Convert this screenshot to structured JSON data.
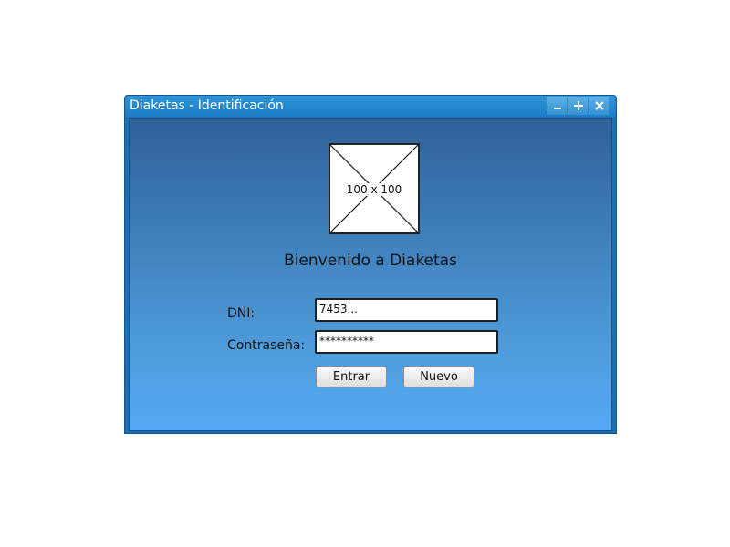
{
  "window": {
    "title": "Diaketas - Identificación",
    "controls": {
      "minimize": "minimize-icon",
      "maximize": "maximize-icon",
      "close": "close-icon"
    }
  },
  "image_placeholder": {
    "label": "100 x 100"
  },
  "welcome": "Bienvenido a Diaketas",
  "form": {
    "dni_label": "DNI:",
    "dni_value": "7453...",
    "password_label": "Contraseña:",
    "password_value": "**********"
  },
  "buttons": {
    "enter": "Entrar",
    "new": "Nuevo"
  },
  "colors": {
    "titlebar": "#1a7cc6",
    "client_top": "#2f6298",
    "client_bottom": "#54a8f4"
  }
}
